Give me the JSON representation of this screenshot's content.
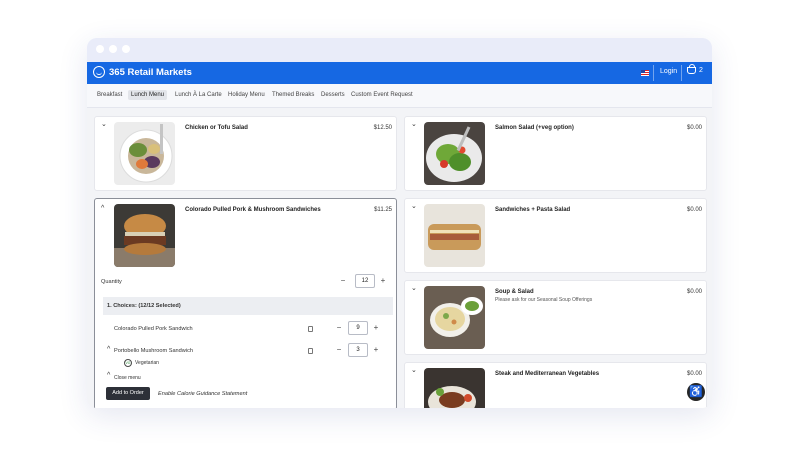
{
  "header": {
    "brand": "365 Retail Markets",
    "login_label": "Login",
    "cart_count": "2"
  },
  "tabs": [
    {
      "label": "Breakfast",
      "active": false
    },
    {
      "label": "Lunch Menu",
      "active": true
    },
    {
      "label": "Lunch À La Carte",
      "active": false
    },
    {
      "label": "Holiday Menu",
      "active": false
    },
    {
      "label": "Themed Breaks",
      "active": false
    },
    {
      "label": "Desserts",
      "active": false
    },
    {
      "label": "Custom Event Request",
      "active": false
    }
  ],
  "left_items": [
    {
      "name": "Chicken or Tofu Salad",
      "price": "$12.50"
    },
    {
      "name": "Colorado Pulled Pork & Mushroom Sandwiches",
      "price": "$11.25"
    }
  ],
  "expanded": {
    "quantity_label": "Quantity",
    "quantity": "12",
    "choices_label": "1. Choices: (12/12 Selected)",
    "choices": [
      {
        "name": "Colorado Pulled Pork Sandwich",
        "qty": "9"
      },
      {
        "name": "Portobello Mushroom Sandwich",
        "qty": "3"
      }
    ],
    "veg_label": "Vegetarian",
    "veg_badge": "VG",
    "close_menu": "Close menu",
    "add_to_order": "Add to Order",
    "calorie_link": "Enable Calorie Guidance Statement"
  },
  "right_items": [
    {
      "name": "Salmon Salad (+veg option)",
      "price": "$0.00",
      "subtitle": ""
    },
    {
      "name": "Sandwiches + Pasta Salad",
      "price": "$0.00",
      "subtitle": ""
    },
    {
      "name": "Soup & Salad",
      "price": "$0.00",
      "subtitle": "Please ask for our Seasonal Soup Offerings"
    },
    {
      "name": "Steak and Mediterranean Vegetables",
      "price": "$0.00",
      "subtitle": ""
    }
  ],
  "icons": {
    "chevron_down": "⌄",
    "chevron_up": "^",
    "minus": "−",
    "plus": "+",
    "accessibility": "♿"
  },
  "colors": {
    "brand": "#1668e3",
    "button": "#2d3038"
  }
}
